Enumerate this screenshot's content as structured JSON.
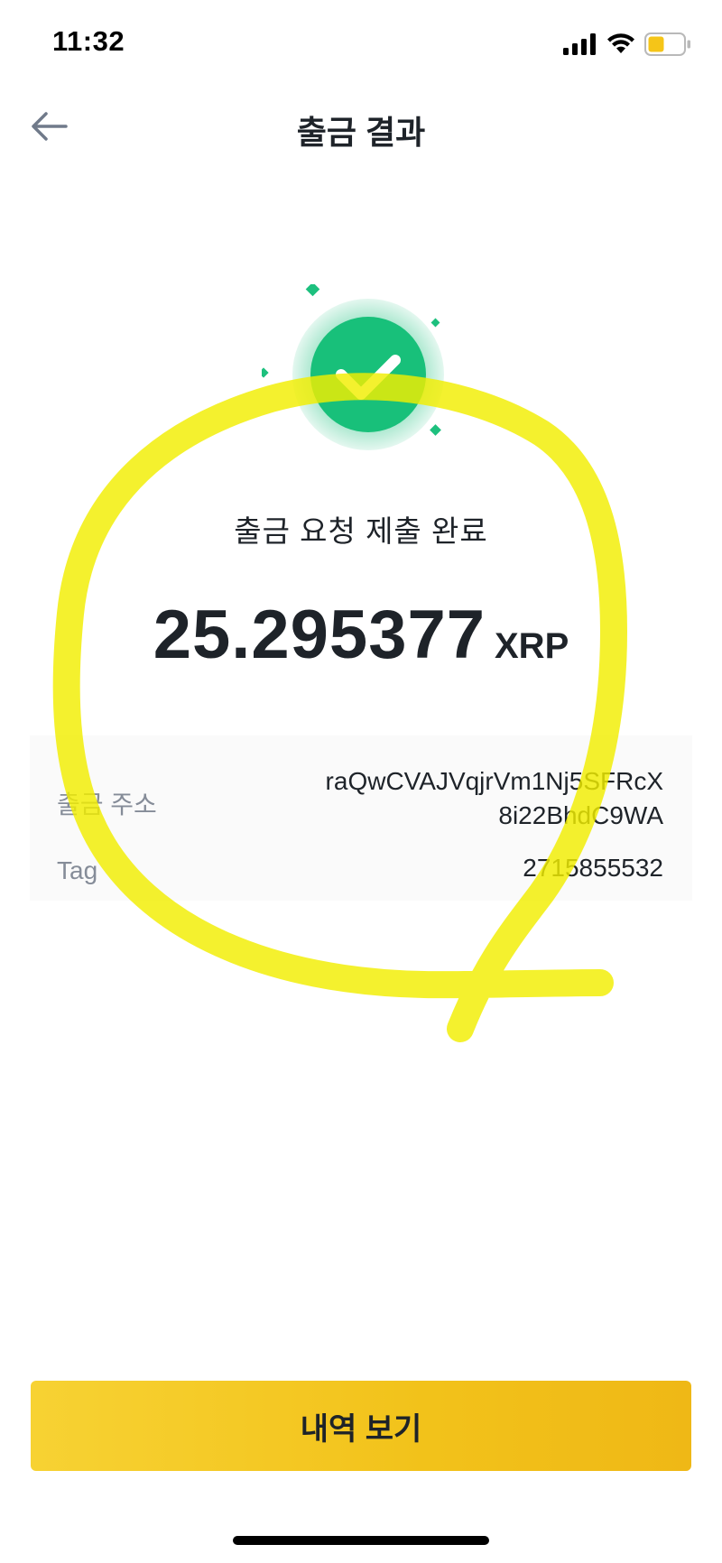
{
  "status_bar": {
    "time": "11:32",
    "icons": [
      "signal-icon",
      "wifi-icon",
      "battery-icon"
    ],
    "battery_color": "#f5c518"
  },
  "header": {
    "back_icon": "arrow-left-icon",
    "title": "출금 결과"
  },
  "result": {
    "icon": "check-circle-icon",
    "accent_color": "#1dc07e",
    "message": "출금 요청 제출 완료",
    "amount": "25.295377",
    "unit": "XRP"
  },
  "details": {
    "address_label": "출금 주소",
    "address_line1": "raQwCVAJVqjrVm1Nj5SFRcX",
    "address_line2": "8i22BhdC9WA",
    "tag_label": "Tag",
    "tag_value": "2715855532"
  },
  "footer": {
    "button_label": "내역 보기",
    "button_color": "#f0b90b"
  },
  "annotation": {
    "highlight_color": "#f2ee00"
  }
}
